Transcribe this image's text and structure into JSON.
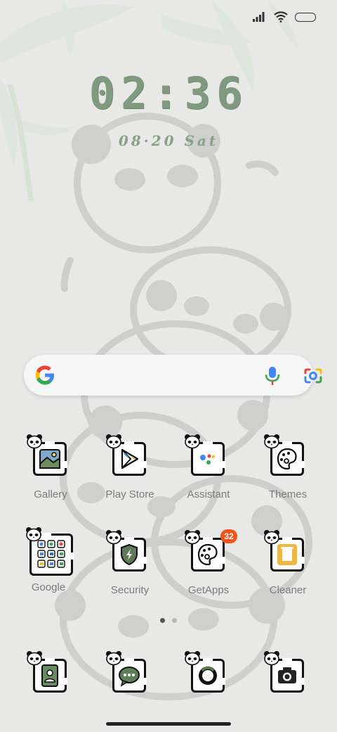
{
  "status_bar": {
    "icons": [
      "signal-icon",
      "wifi-icon",
      "battery-icon"
    ]
  },
  "clock": {
    "time": "02:36",
    "date": "08·20 Sat"
  },
  "search": {
    "icons": [
      "google-g-icon",
      "microphone-icon",
      "google-lens-icon"
    ]
  },
  "apps": [
    {
      "label": "Gallery"
    },
    {
      "label": "Play Store"
    },
    {
      "label": "Assistant"
    },
    {
      "label": "Themes"
    },
    {
      "label": "Google"
    },
    {
      "label": "Security"
    },
    {
      "label": "GetApps",
      "badge": "32"
    },
    {
      "label": "Cleaner"
    }
  ],
  "dock": [
    {
      "icon": "contacts-icon"
    },
    {
      "icon": "messages-icon"
    },
    {
      "icon": "browser-icon"
    },
    {
      "icon": "camera-icon"
    }
  ],
  "page_indicator": {
    "count": 2,
    "active": 1
  },
  "colors": {
    "background": "#e8e8e7",
    "clock": "#7f9a7f",
    "badge": "#f0531c",
    "label": "#7a7a7a"
  }
}
